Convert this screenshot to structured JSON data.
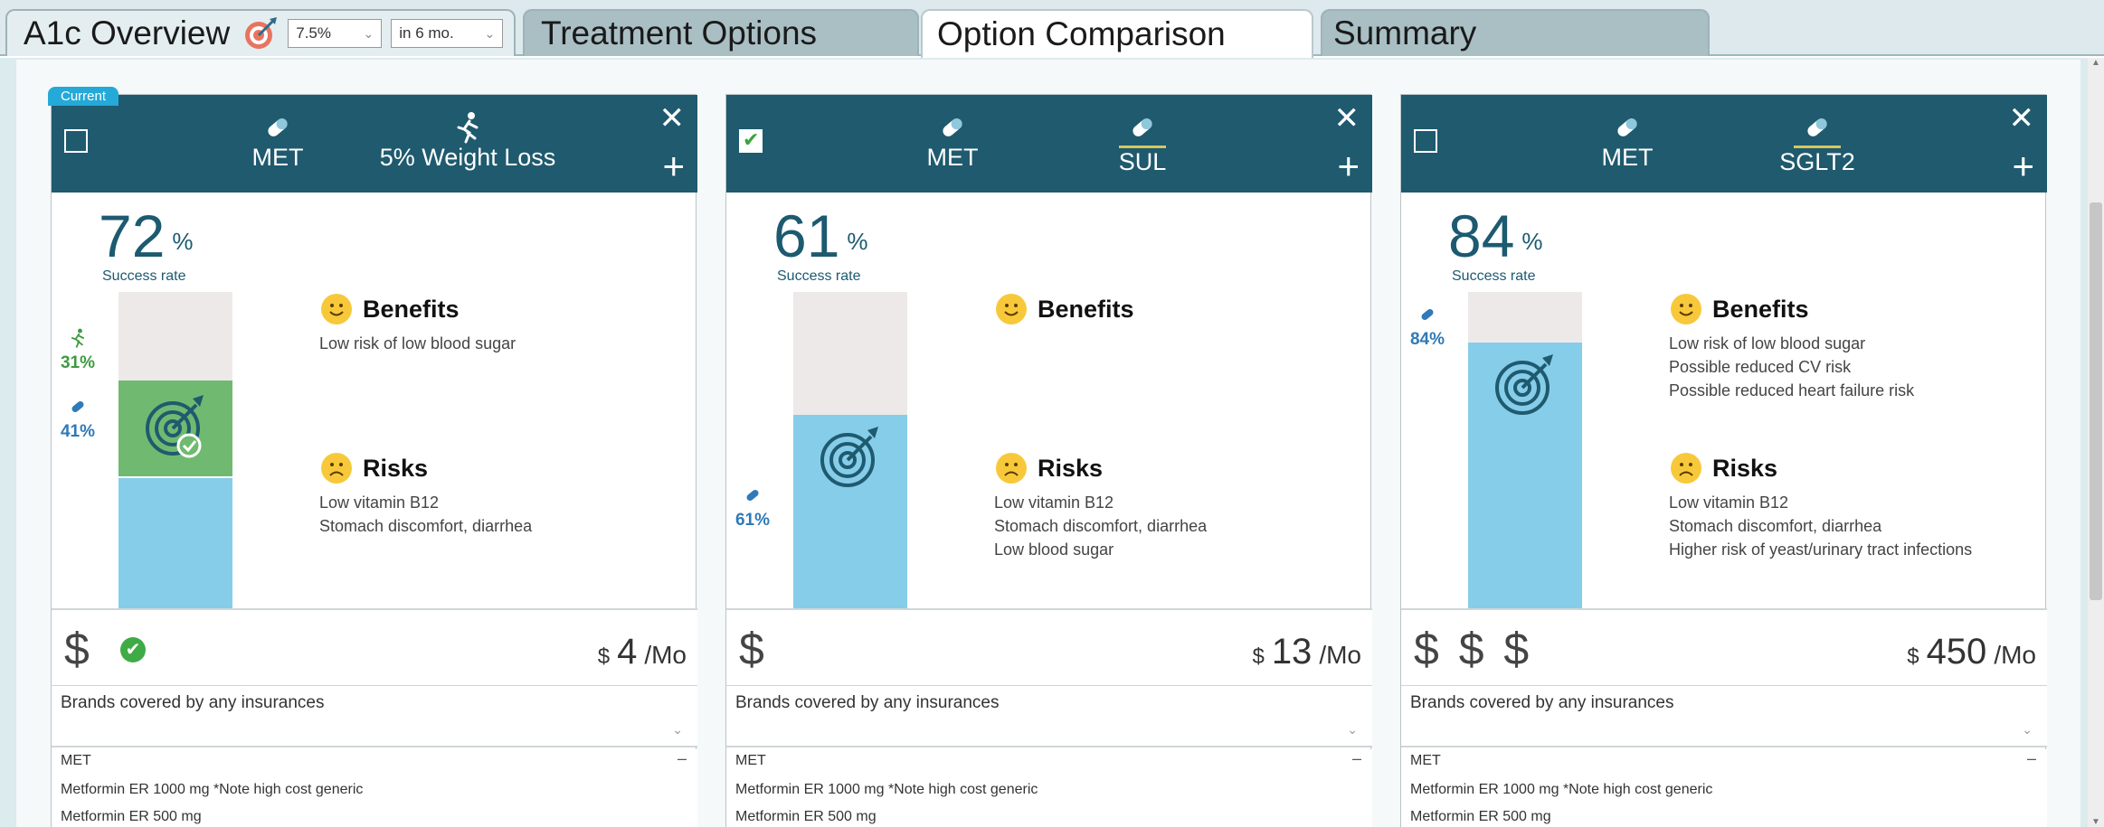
{
  "tabs": {
    "overview": {
      "label": "A1c Overview",
      "goal_value": "7.5%",
      "goal_timeframe": "in 6 mo."
    },
    "treatment_options": {
      "label": "Treatment Options"
    },
    "option_comparison": {
      "label": "Option Comparison"
    },
    "summary": {
      "label": "Summary"
    }
  },
  "colors": {
    "header": "#1f5a6e",
    "bar_blue": "#86cdea",
    "bar_green": "#6fba70",
    "accent_green": "#3fab46",
    "badge": "#25a9d8"
  },
  "cards": [
    {
      "current_badge": "Current",
      "selected": false,
      "meds": [
        {
          "icon": "pill-icon",
          "label": "MET"
        },
        {
          "icon": "running-person-icon",
          "label": "5% Weight Loss"
        }
      ],
      "success_pct": "72",
      "pct_unit": "%",
      "success_label": "Success rate",
      "side_labels": [
        {
          "icon": "running-person-icon",
          "value": "31%"
        },
        {
          "icon": "pill-icon",
          "value": "41%"
        }
      ],
      "benefits_title": "Benefits",
      "benefits": [
        "Low risk of low blood sugar"
      ],
      "risks_title": "Risks",
      "risks": [
        "Low vitamin B12",
        "Stomach discomfort, diarrhea"
      ],
      "cost_level": "$",
      "price_currency": "$",
      "price_value": "4",
      "price_unit": "/Mo",
      "brands_label": "Brands covered by any insurances",
      "list_header": "MET",
      "list_items": [
        "Metformin ER 1000 mg *Note high cost generic",
        "Metformin ER 500 mg"
      ]
    },
    {
      "selected": true,
      "meds": [
        {
          "icon": "pill-icon",
          "label": "MET"
        },
        {
          "icon": "pill-icon",
          "label": "SUL"
        }
      ],
      "success_pct": "61",
      "pct_unit": "%",
      "success_label": "Success rate",
      "side_labels": [
        {
          "icon": "pill-icon",
          "value": "61%"
        }
      ],
      "benefits_title": "Benefits",
      "benefits": [],
      "risks_title": "Risks",
      "risks": [
        "Low vitamin B12",
        "Stomach discomfort, diarrhea",
        "Low blood sugar"
      ],
      "cost_level": "$",
      "price_currency": "$",
      "price_value": "13",
      "price_unit": "/Mo",
      "brands_label": "Brands covered by any insurances",
      "list_header": "MET",
      "list_items": [
        "Metformin ER 1000 mg *Note high cost generic",
        "Metformin ER 500 mg"
      ]
    },
    {
      "selected": false,
      "meds": [
        {
          "icon": "pill-icon",
          "label": "MET"
        },
        {
          "icon": "pill-icon",
          "label": "SGLT2"
        }
      ],
      "success_pct": "84",
      "pct_unit": "%",
      "success_label": "Success rate",
      "side_labels": [
        {
          "icon": "pill-icon",
          "value": "84%"
        }
      ],
      "benefits_title": "Benefits",
      "benefits": [
        "Low risk of low blood sugar",
        "Possible reduced CV risk",
        "Possible reduced heart failure risk"
      ],
      "risks_title": "Risks",
      "risks": [
        "Low vitamin B12",
        "Stomach discomfort, diarrhea",
        "Higher risk of yeast/urinary tract infections"
      ],
      "cost_level": "$ $ $",
      "price_currency": "$",
      "price_value": "450",
      "price_unit": "/Mo",
      "brands_label": "Brands covered by any insurances",
      "list_header": "MET",
      "list_items": [
        "Metformin ER 1000 mg *Note high cost generic",
        "Metformin ER 500 mg"
      ]
    }
  ]
}
